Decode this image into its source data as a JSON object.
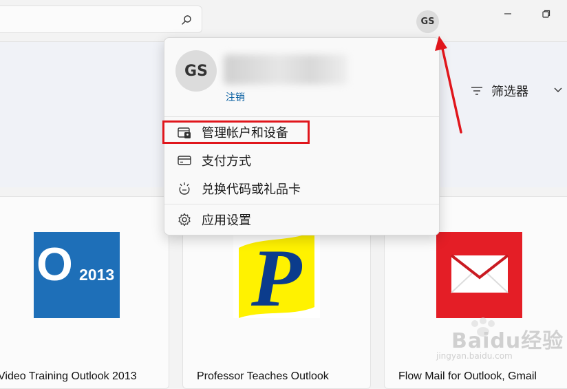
{
  "search": {
    "placeholder": ""
  },
  "account": {
    "initials": "GS",
    "signout": "注销"
  },
  "filter": {
    "label": "筛选器"
  },
  "menu": {
    "items": [
      {
        "label": "管理帐户和设备",
        "icon": "account-devices-icon"
      },
      {
        "label": "支付方式",
        "icon": "credit-card-icon"
      },
      {
        "label": "兑换代码或礼品卡",
        "icon": "gift-icon"
      },
      {
        "label": "应用设置",
        "icon": "gear-icon"
      }
    ]
  },
  "apps": [
    {
      "title": "Video Training Outlook 2013",
      "icon_text": "2013",
      "icon_letter": "O",
      "color": "#1e6fb8"
    },
    {
      "title": "Professor Teaches Outlook",
      "icon_letter": "P",
      "color": "#fff200"
    },
    {
      "title": "Flow Mail for Outlook, Gmail",
      "color": "#e41e26"
    }
  ],
  "annotation": {
    "highlight_color": "#e0161c"
  },
  "watermark": {
    "text": "Baidu经验",
    "sub": "jingyan.baidu.com"
  }
}
